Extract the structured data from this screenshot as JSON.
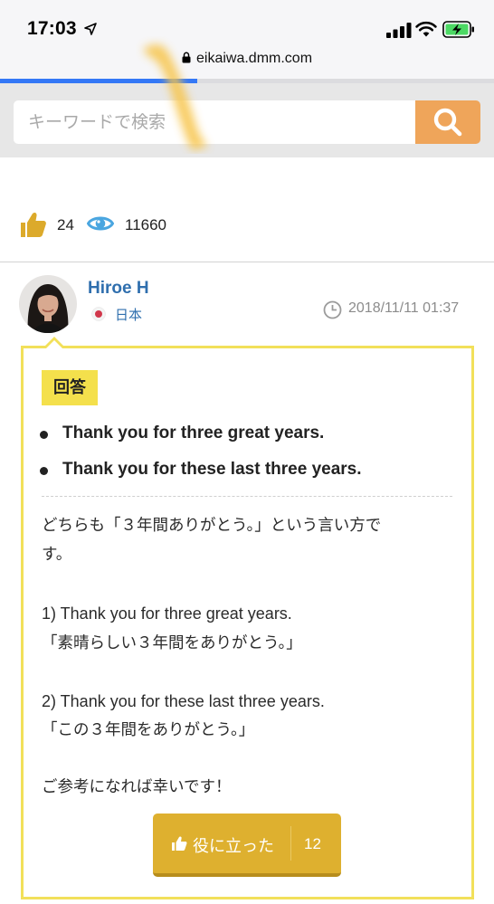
{
  "status_bar": {
    "time": "17:03",
    "icons": [
      "location-arrow-icon",
      "signal-icon",
      "wifi-icon",
      "battery-charging-icon"
    ]
  },
  "browser": {
    "url": "eikaiwa.dmm.com",
    "lock_icon": "lock-icon",
    "load_progress": 0.4
  },
  "search": {
    "placeholder": "キーワードで検索",
    "button_icon": "search-icon"
  },
  "stats": {
    "likes": "24",
    "views": "11660",
    "like_icon": "thumbs-up-icon",
    "view_icon": "eye-icon"
  },
  "answer": {
    "author": "Hiroe H",
    "country": "日本",
    "timestamp": "2018/11/11 01:37",
    "badge": "回答",
    "phrases": [
      "Thank you for three great years.",
      "Thank you for these last three years."
    ],
    "body_lines": [
      "どちらも「３年間ありがとう。」という言い方で",
      "す。",
      "",
      "1) Thank you for three great years.",
      "「素晴らしい３年間をありがとう。」",
      "",
      "2) Thank you for these last three years.",
      "「この３年間をありがとう。」",
      "",
      "ご参考になれば幸いです！"
    ],
    "helpful_label": "役に立った",
    "helpful_count": "12"
  },
  "colors": {
    "search_button": "#efa55a",
    "like_icon": "#dcaa2b",
    "view_icon": "#4aa6e0",
    "author_link": "#2f6fae",
    "card_border": "#f2e05a",
    "badge_bg": "#f4e04c",
    "helpful_button": "#deb02f",
    "progress": "#3478f6"
  }
}
